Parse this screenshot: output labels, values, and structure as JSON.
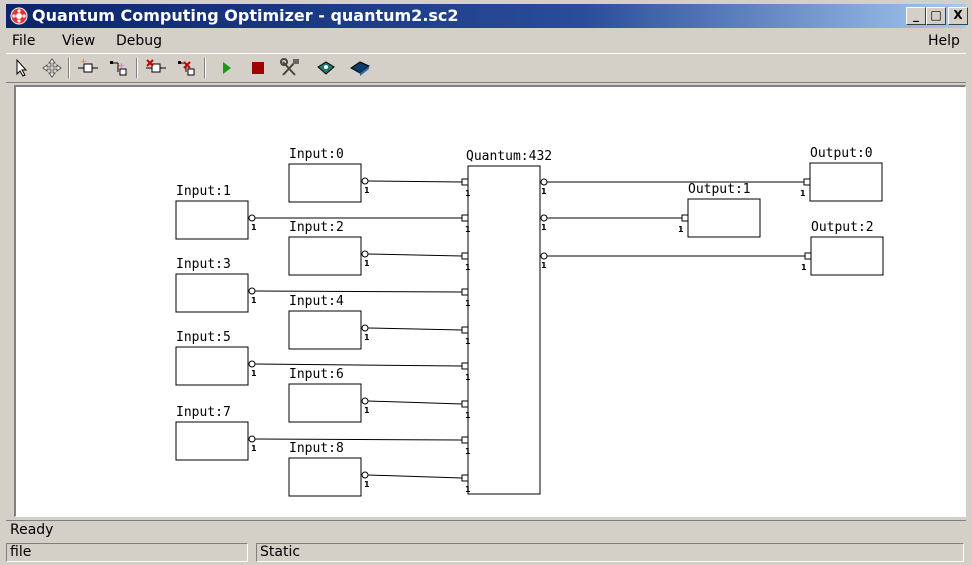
{
  "window": {
    "title": "Quantum Computing Optimizer - quantum2.sc2",
    "controls": {
      "minimize": "_",
      "maximize": "□",
      "close": "X"
    }
  },
  "menubar": {
    "file": "File",
    "view": "View",
    "debug": "Debug",
    "help": "Help"
  },
  "toolbar": {
    "icons": [
      "select-arrow-icon",
      "move-icon",
      "add-input-icon",
      "add-output-icon",
      "remove-input-icon",
      "remove-output-icon",
      "run-icon",
      "stop-icon",
      "tools-icon",
      "step-icon",
      "book-icon"
    ],
    "run_color": "#1a9a1a",
    "stop_color": "#a00000"
  },
  "diagram": {
    "quantum": {
      "label": "Quantum:432",
      "pin": "1"
    },
    "inputs": [
      {
        "label": "Input:0",
        "pin": "1"
      },
      {
        "label": "Input:1",
        "pin": "1"
      },
      {
        "label": "Input:2",
        "pin": "1"
      },
      {
        "label": "Input:3",
        "pin": "1"
      },
      {
        "label": "Input:4",
        "pin": "1"
      },
      {
        "label": "Input:5",
        "pin": "1"
      },
      {
        "label": "Input:6",
        "pin": "1"
      },
      {
        "label": "Input:7",
        "pin": "1"
      },
      {
        "label": "Input:8",
        "pin": "1"
      }
    ],
    "outputs": [
      {
        "label": "Output:0",
        "pin": "1"
      },
      {
        "label": "Output:1",
        "pin": "1"
      },
      {
        "label": "Output:2",
        "pin": "1"
      }
    ]
  },
  "status": {
    "message": "Ready",
    "pane_file": "file",
    "pane_static": "Static"
  }
}
